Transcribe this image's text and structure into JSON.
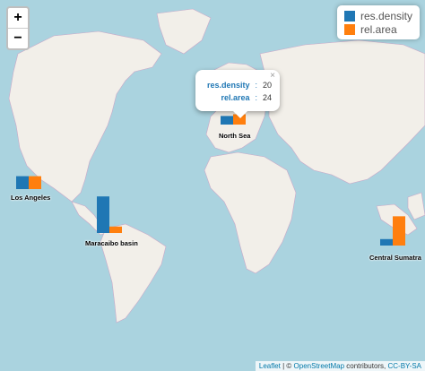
{
  "zoom": {
    "in_label": "+",
    "out_label": "−"
  },
  "legend": [
    {
      "label": "res.density",
      "color": "#1f77b4"
    },
    {
      "label": "rel.area",
      "color": "#ff7f0e"
    }
  ],
  "popup": {
    "close": "×",
    "rows": [
      {
        "key": "res.density",
        "value": "20"
      },
      {
        "key": "rel.area",
        "value": "24"
      }
    ]
  },
  "chart_data": {
    "type": "bar",
    "categories": [
      "North Sea",
      "Los Angeles",
      "Maracaibo basin",
      "Central Sumatra"
    ],
    "series": [
      {
        "name": "res.density",
        "values": [
          20,
          30,
          85,
          15
        ]
      },
      {
        "name": "rel.area",
        "values": [
          24,
          30,
          15,
          68
        ]
      }
    ]
  },
  "attribution": {
    "leaflet": "Leaflet",
    "sep": " | © ",
    "osm": "OpenStreetMap",
    "contrib": " contributors, ",
    "license": "CC-BY-SA"
  }
}
